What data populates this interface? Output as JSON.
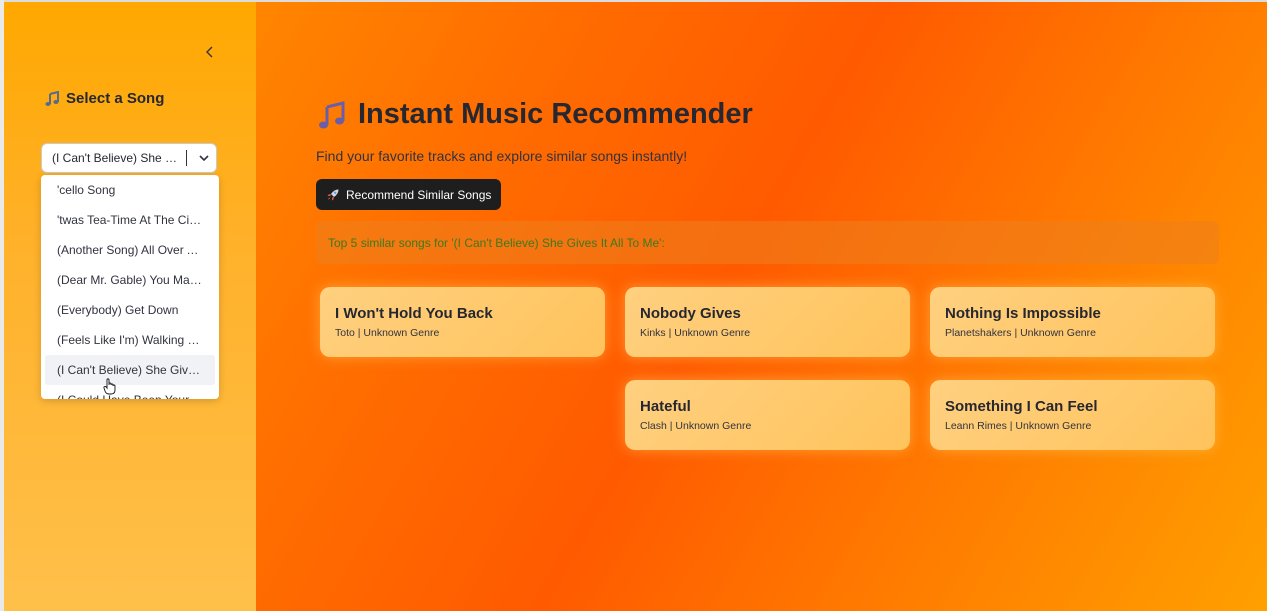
{
  "sidebar": {
    "title": "Select a Song",
    "select_value": "(I Can't Believe) She Giv…",
    "options": [
      "'cello Song",
      "'twas Tea-Time At The Circus",
      "(Another Song) All Over Again",
      "(Dear Mr. Gable) You Made …",
      "(Everybody) Get Down",
      "(Feels Like I'm) Walking On …",
      "(I Can't Believe) She Gives It…",
      "(I Could Have Been Your) Be…"
    ],
    "highlighted_option_index": 6
  },
  "main": {
    "title": "Instant Music Recommender",
    "subtitle": "Find your favorite tracks and explore similar songs instantly!",
    "button_label": "Recommend Similar Songs",
    "result_text": "Top 5 similar songs for '(I Can't Believe) She Gives It All To Me':",
    "cards": [
      {
        "title": "I Won't Hold You Back",
        "meta": "Toto | Unknown Genre"
      },
      {
        "title": "Nobody Gives",
        "meta": "Kinks | Unknown Genre"
      },
      {
        "title": "Nothing Is Impossible",
        "meta": "Planetshakers | Unknown Genre"
      },
      {
        "title": "Hateful",
        "meta": "Clash | Unknown Genre"
      },
      {
        "title": "Something I Can Feel",
        "meta": "Leann Rimes | Unknown Genre"
      }
    ]
  },
  "icons": {
    "collapse": "chevron-left-icon",
    "sidebar_title": "musical-note-icon",
    "select": "chevron-down-icon",
    "main_title": "musical-notes-icon",
    "button": "rocket-icon",
    "cursor": "hand-pointer-icon"
  },
  "colors": {
    "button_bg": "#1e1e1e",
    "result_text": "#3b7a1f",
    "card_bg": "#ffc35c"
  }
}
